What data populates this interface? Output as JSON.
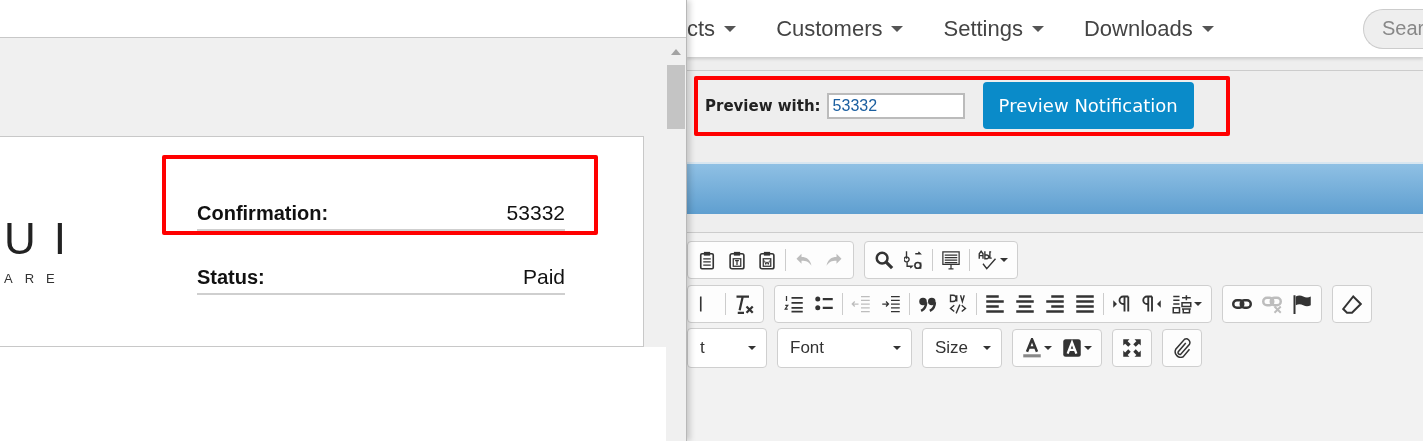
{
  "popup": {
    "logo": {
      "mark": "UI",
      "tagline": "ARE"
    },
    "details": [
      {
        "label": "Confirmation:",
        "value": "53332",
        "highlighted": true
      },
      {
        "label": "Status:",
        "value": "Paid",
        "highlighted": false
      }
    ]
  },
  "nav": {
    "items": [
      {
        "label": "cts"
      },
      {
        "label": "Customers"
      },
      {
        "label": "Settings"
      },
      {
        "label": "Downloads"
      }
    ],
    "search": {
      "placeholder": "Sear"
    }
  },
  "preview": {
    "label": "Preview with:",
    "value": "53332",
    "button": "Preview Notification",
    "highlighted": true
  },
  "toolbar": {
    "rows": [
      [
        {
          "buttons": [
            {
              "kind": "paste",
              "disabled": false
            },
            {
              "kind": "paste-text",
              "disabled": false
            },
            {
              "kind": "paste-word",
              "disabled": false
            },
            {
              "kind": "sep"
            },
            {
              "kind": "undo",
              "disabled": true
            },
            {
              "kind": "redo",
              "disabled": true
            }
          ]
        },
        {
          "buttons": [
            {
              "kind": "search",
              "disabled": false
            },
            {
              "kind": "replace",
              "disabled": false
            },
            {
              "kind": "sep"
            },
            {
              "kind": "template",
              "disabled": false
            },
            {
              "kind": "sep"
            },
            {
              "kind": "spellcheck",
              "disabled": false
            }
          ]
        }
      ],
      [
        {
          "buttons": [
            {
              "kind": "strike",
              "disabled": false
            },
            {
              "kind": "sep"
            },
            {
              "kind": "clear-format",
              "disabled": false
            }
          ]
        },
        {
          "buttons": [
            {
              "kind": "numbered-list",
              "disabled": false
            },
            {
              "kind": "bullet-list",
              "disabled": false
            },
            {
              "kind": "sep"
            },
            {
              "kind": "outdent",
              "disabled": true
            },
            {
              "kind": "indent",
              "disabled": false
            },
            {
              "kind": "sep"
            },
            {
              "kind": "quote",
              "disabled": false
            },
            {
              "kind": "div",
              "disabled": false
            },
            {
              "kind": "sep"
            },
            {
              "kind": "align-left",
              "disabled": false
            },
            {
              "kind": "align-center",
              "disabled": false
            },
            {
              "kind": "align-right",
              "disabled": false
            },
            {
              "kind": "justify",
              "disabled": false
            },
            {
              "kind": "sep"
            },
            {
              "kind": "ltr",
              "disabled": false
            },
            {
              "kind": "rtl",
              "disabled": false
            },
            {
              "kind": "language",
              "disabled": false
            }
          ]
        },
        {
          "buttons": [
            {
              "kind": "link",
              "disabled": false
            },
            {
              "kind": "unlink",
              "disabled": true
            },
            {
              "kind": "flag",
              "disabled": false
            }
          ]
        },
        {
          "buttons": [
            {
              "kind": "eraser",
              "disabled": false
            }
          ]
        }
      ],
      [
        {
          "buttons": [
            {
              "kind": "dropdown",
              "label": "t",
              "wide": false
            }
          ]
        },
        {
          "buttons": [
            {
              "kind": "dropdown",
              "label": "Font",
              "wide": true
            }
          ]
        },
        {
          "buttons": [
            {
              "kind": "dropdown",
              "label": "Size",
              "wide": false
            }
          ]
        },
        {
          "buttons": [
            {
              "kind": "text-color",
              "disabled": false
            },
            {
              "kind": "bg-color",
              "disabled": false
            }
          ]
        },
        {
          "buttons": [
            {
              "kind": "maximize",
              "disabled": false
            }
          ]
        },
        {
          "buttons": [
            {
              "kind": "attach",
              "disabled": false
            }
          ]
        }
      ]
    ]
  }
}
